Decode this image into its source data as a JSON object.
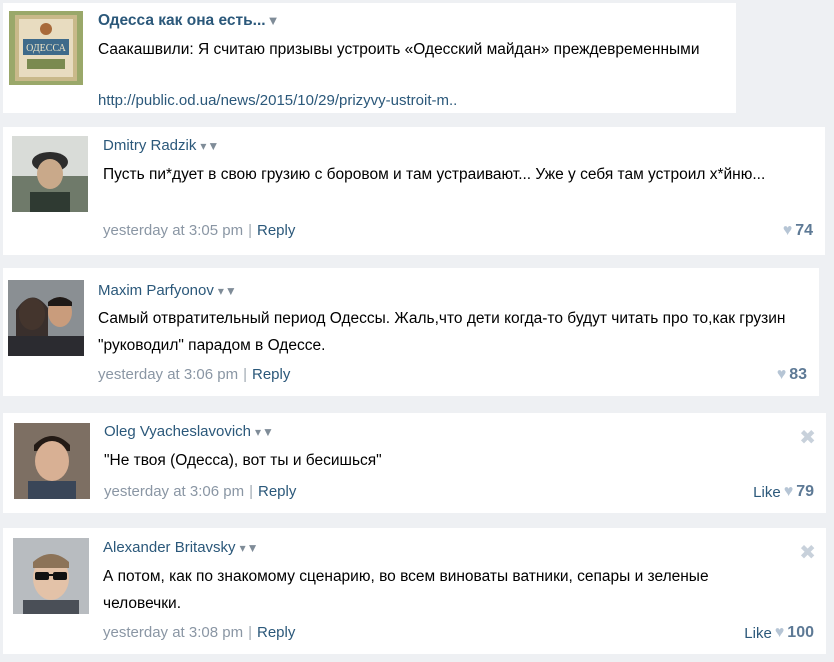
{
  "post": {
    "group_name": "Одесса как она есть...",
    "group_menu_icon": "triangle-down-icon",
    "title": "Саакашвили: Я считаю призывы устроить «Одесский майдан» преждевременными",
    "link": "http://public.od.ua/news/2015/10/29/prizyvy-ustroit-m.."
  },
  "comments": [
    {
      "author": "Dmitry Radzik",
      "text": "Пусть пи*дует в свою грузию с боровом и там устраивают... Уже у себя там устроил х*йню...",
      "time": "yesterday at 3:05 pm",
      "reply": "Reply",
      "separator": "|",
      "like_label": "",
      "likes": "74"
    },
    {
      "author": "Maxim Parfyonov",
      "text": "Самый отвратительный период Одессы. Жаль,что дети когда-то будут читать про то,как грузин \"руководил\" парадом в Одессе.",
      "time": "yesterday at 3:06 pm",
      "reply": "Reply",
      "separator": "|",
      "like_label": "",
      "likes": "83"
    },
    {
      "author": "Oleg Vyacheslavovich",
      "text": "\"Не твоя (Одесса), вот ты и бесишься\"",
      "time": "yesterday at 3:06 pm",
      "reply": "Reply",
      "separator": "|",
      "like_label": "Like",
      "likes": "79"
    },
    {
      "author": "Alexander Britavsky",
      "text": "А потом, как по знакомому сценарию, во всем виноваты ватники, сепары и зеленые человечки.",
      "time": "yesterday at 3:08 pm",
      "reply": "Reply",
      "separator": "|",
      "like_label": "Like",
      "likes": "100"
    }
  ],
  "icons": {
    "heart": "♥",
    "close": "✖",
    "menu": "▾▼"
  },
  "colors": {
    "link": "#2b587a",
    "meta": "#8a96a4",
    "likes": "#5d7995",
    "heart": "#b6c5d5",
    "background": "#eef0f3"
  }
}
